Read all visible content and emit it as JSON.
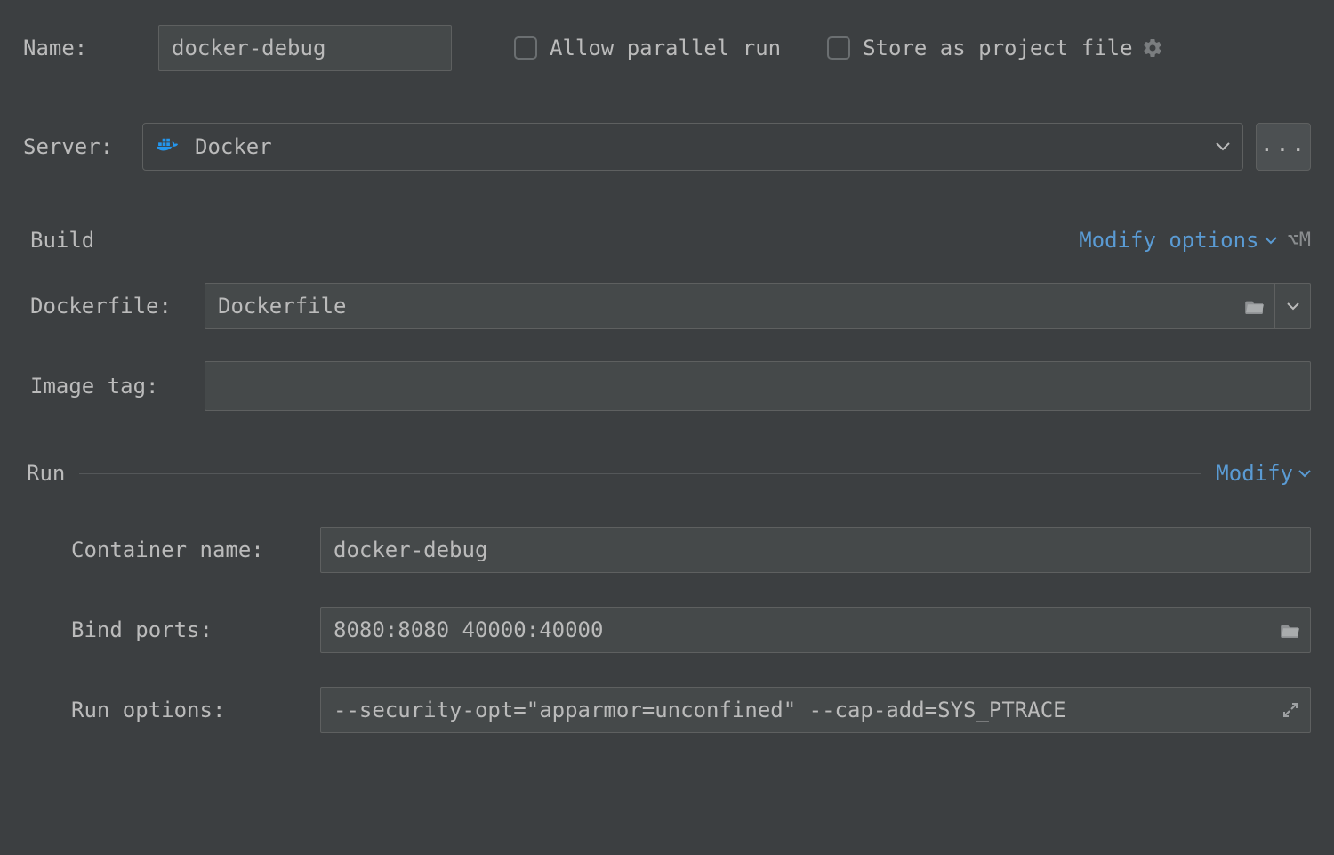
{
  "name": {
    "label": "Name:",
    "value": "docker-debug"
  },
  "allow_parallel": {
    "label": "Allow parallel run",
    "checked": false
  },
  "store_as_project": {
    "label": "Store as project file",
    "checked": false
  },
  "server": {
    "label": "Server:",
    "value": "Docker",
    "more_label": "..."
  },
  "build": {
    "title": "Build",
    "modify_link": "Modify options",
    "shortcut": "⌥M",
    "dockerfile": {
      "label": "Dockerfile:",
      "value": "Dockerfile"
    },
    "image_tag": {
      "label": "Image tag:",
      "value": ""
    }
  },
  "run": {
    "title": "Run",
    "modify_link": "Modify",
    "container_name": {
      "label": "Container name:",
      "value": "docker-debug"
    },
    "bind_ports": {
      "label": "Bind ports:",
      "value": "8080:8080 40000:40000"
    },
    "run_options": {
      "label": "Run options:",
      "value": "--security-opt=\"apparmor=unconfined\" --cap-add=SYS_PTRACE"
    }
  }
}
